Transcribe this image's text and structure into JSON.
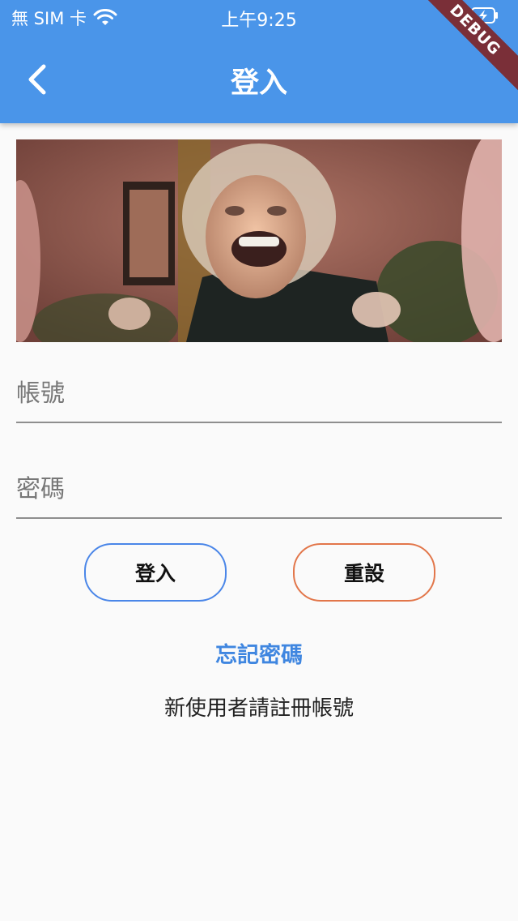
{
  "status_bar": {
    "carrier": "無 SIM 卡",
    "time": "上午9:25"
  },
  "debug_banner": "DEBUG",
  "app_bar": {
    "title": "登入",
    "back_icon": "chevron-left-icon",
    "color": "#4a95e9"
  },
  "form": {
    "account_placeholder": "帳號",
    "password_placeholder": "密碼"
  },
  "buttons": {
    "login_label": "登入",
    "login_border_color": "#4a86e8",
    "reset_label": "重設",
    "reset_border_color": "#e2764a"
  },
  "links": {
    "forgot_password": "忘記密碼",
    "register": "新使用者請註冊帳號"
  },
  "colors": {
    "primary": "#4a95e9",
    "link": "#3f86e0",
    "background": "#fafafa"
  }
}
